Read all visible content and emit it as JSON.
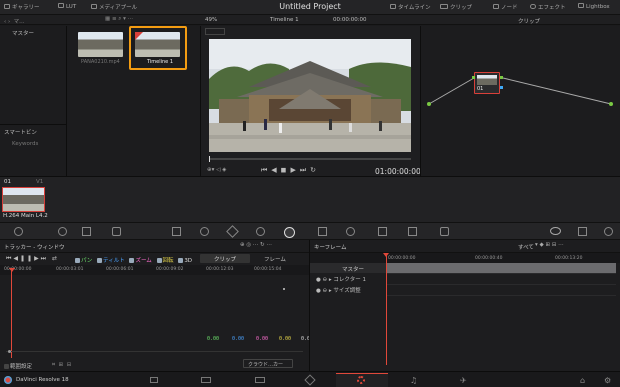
{
  "app": {
    "title": "Untitled Project",
    "product": "DaVinci Resolve 18"
  },
  "topbar": {
    "gallery": "ギャラリー",
    "lut": "LUT",
    "media_pool": "メディアプール",
    "timeline": "タイムライン",
    "clips": "クリップ",
    "nodes": "ノード",
    "effects": "エフェクト",
    "lightbox": "Lightbox"
  },
  "toolbar": {
    "zoom": "49%",
    "timeline_select": "Timeline 1",
    "timecode_top": "00:00:00:00",
    "clip_menu": "クリップ"
  },
  "media_pool": {
    "folder_root": "マスター",
    "smart_bins": "スマートビン",
    "keywords": "Keywords",
    "items": [
      {
        "name": "PANA0210.mp4"
      },
      {
        "name": "Timeline 1"
      }
    ]
  },
  "viewer": {
    "timecode": "01:00:00:00"
  },
  "node": {
    "number": "01"
  },
  "clip_strip": {
    "clip_number": "01",
    "track": "V1",
    "codec": "H.264 Main L4.2"
  },
  "tracker": {
    "panel_title": "トラッカー - ウィンドウ",
    "toggles": [
      "パン",
      "ティルト",
      "ズーム",
      "回転",
      "3D"
    ],
    "tab_clip": "クリップ",
    "tab_frame": "フレーム",
    "ruler": [
      "00:00:00:00",
      "00:00:03:01",
      "00:00:06:01",
      "00:00:09:02",
      "00:00:12:03",
      "00:00:15:04"
    ],
    "values": [
      "0.00",
      "0.00",
      "0.00",
      "0.00",
      "0.00"
    ],
    "interactive": "範囲設定",
    "cloud_tracker": "クラウド…カー"
  },
  "keyframes": {
    "panel_title": "キーフレーム",
    "filter": "すべて",
    "ruler": [
      "00:00:00:00",
      "00:00:00:40",
      "00:00:13:20"
    ],
    "tracks": [
      "マスター",
      "コレクター 1",
      "サイズ調整"
    ]
  },
  "colors": {
    "accent_orange": "#f39c12",
    "playhead_red": "#e0483a",
    "node_green": "#7ac943",
    "node_blue": "#3fa9f5"
  }
}
